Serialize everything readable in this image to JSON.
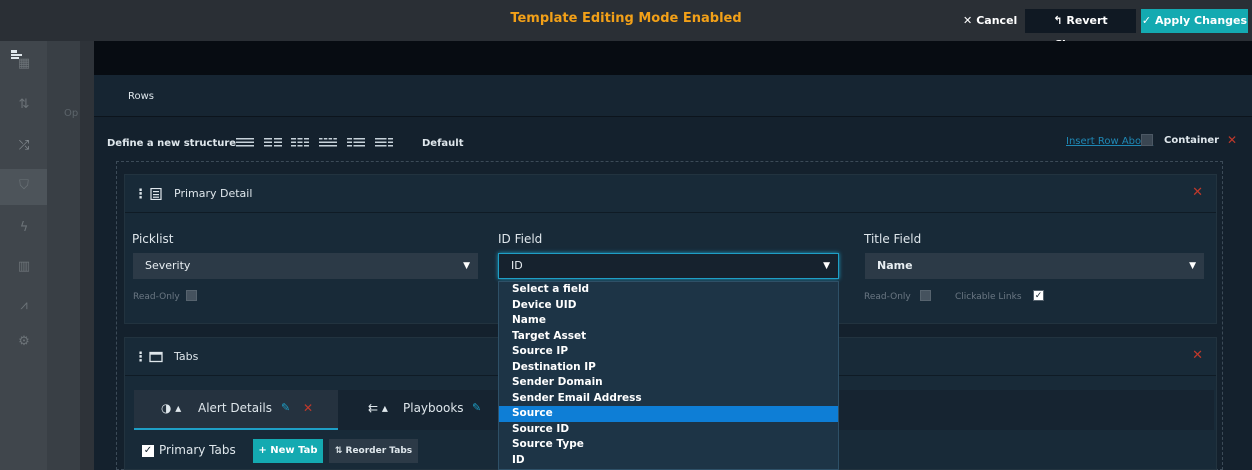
{
  "topbar": {
    "title": "Template Editing Mode Enabled",
    "cancel_label": "Cancel",
    "revert_label": "Revert Changes",
    "apply_label": "Apply Changes"
  },
  "sidebar": {
    "ghost_text": "Op"
  },
  "rows": {
    "label": "Rows"
  },
  "structure": {
    "define_label": "Define a new structure",
    "default_label": "Default",
    "insert_row_label": "Insert Row Above",
    "container_label": "Container"
  },
  "primary_detail": {
    "title": "Primary Detail",
    "picklist": {
      "label": "Picklist",
      "value": "Severity",
      "readonly_label": "Read-Only"
    },
    "id_field": {
      "label": "ID Field",
      "value": "ID"
    },
    "title_field": {
      "label": "Title Field",
      "value": "Name",
      "readonly_label": "Read-Only",
      "clickable_links_label": "Clickable Links"
    }
  },
  "tabs_panel": {
    "title": "Tabs",
    "tabs": [
      {
        "label": "Alert Details"
      },
      {
        "label": "Playbooks"
      }
    ],
    "primary_tabs_label": "Primary Tabs",
    "new_tab_label": "New Tab",
    "reorder_tabs_label": "Reorder Tabs"
  },
  "dropdown": {
    "options": [
      "Select a field",
      "Device UID",
      "Name",
      "Target Asset",
      "Source IP",
      "Destination IP",
      "Sender Domain",
      "Sender Email Address",
      "Source",
      "Source ID",
      "Source Type",
      "ID"
    ],
    "selected": "Source"
  },
  "colors": {
    "accent": "#14aab1",
    "title_orange": "#f2a018",
    "danger": "#c0392b",
    "selected_option": "#0e7ed6"
  }
}
